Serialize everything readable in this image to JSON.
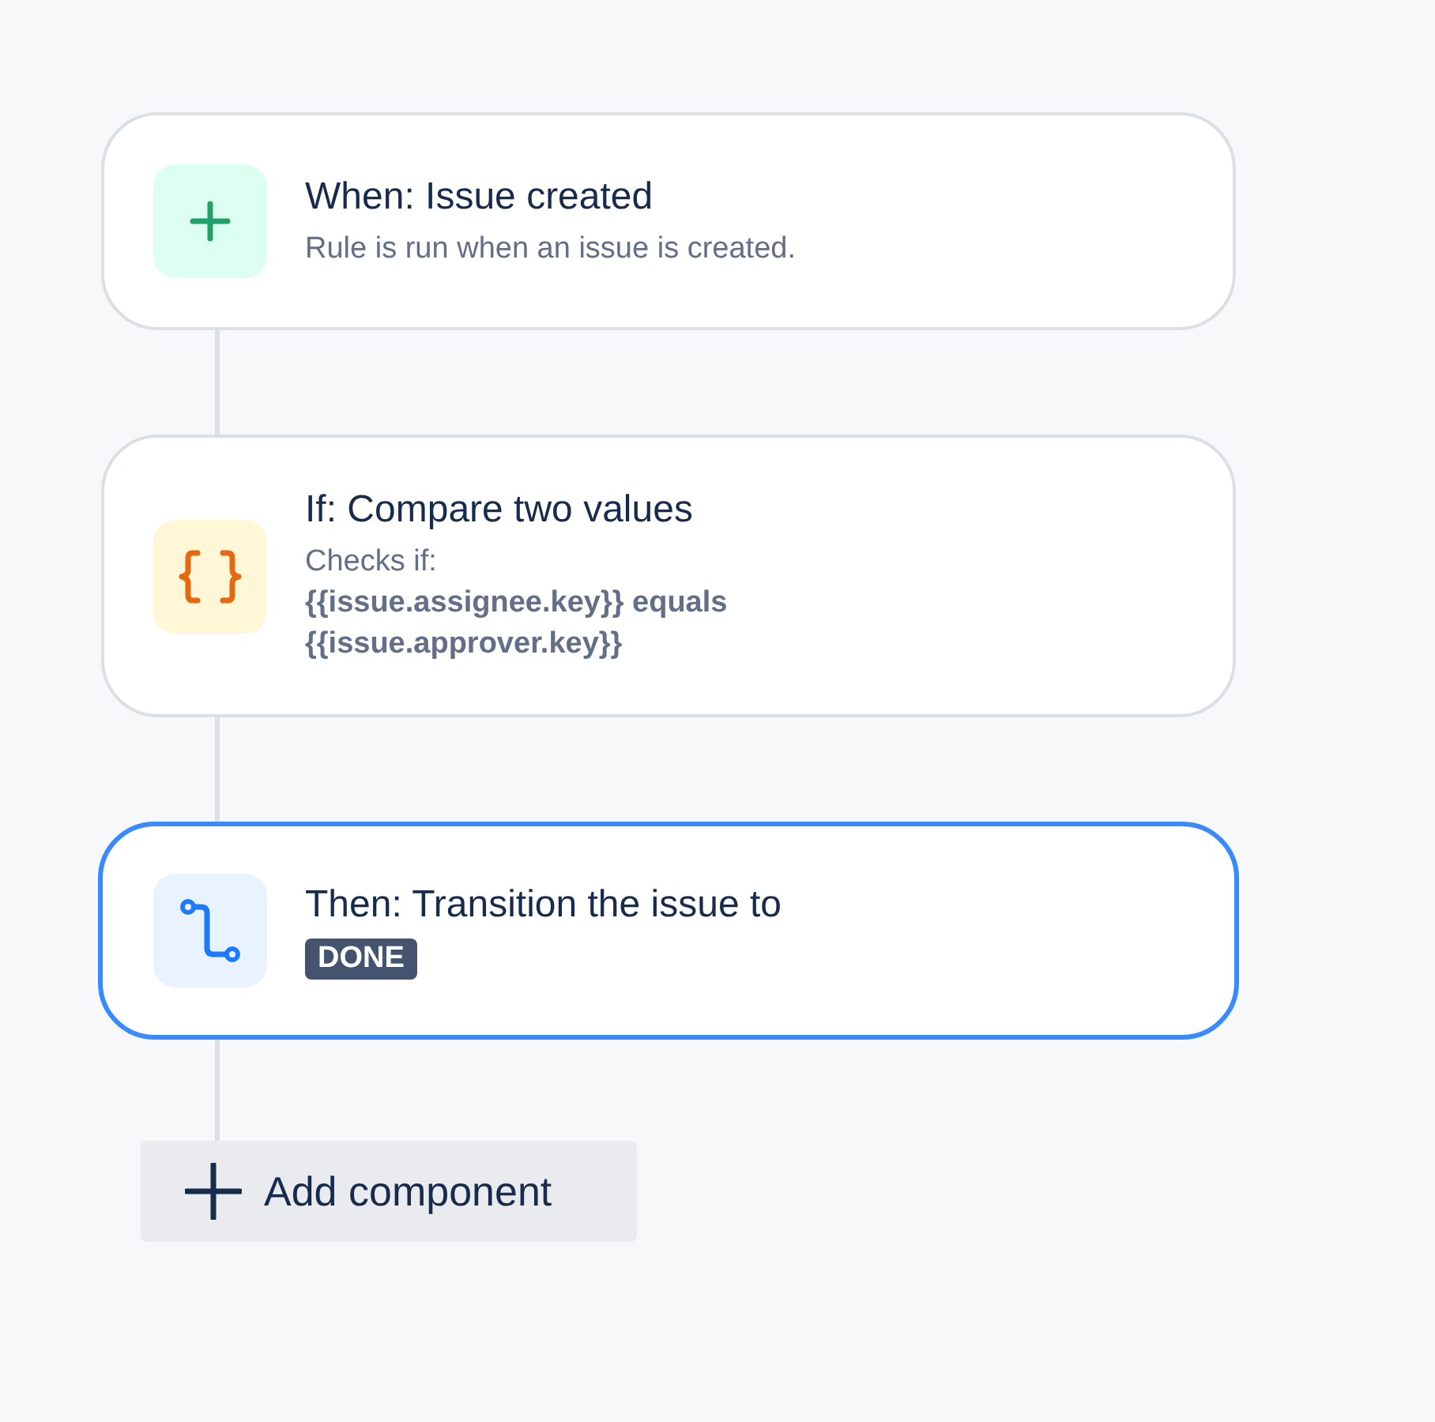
{
  "components": [
    {
      "kind": "trigger",
      "title": "When: Issue created",
      "description": "Rule is run when an issue is created.",
      "selected": false
    },
    {
      "kind": "condition",
      "title": "If: Compare two values",
      "description": "Checks if:",
      "detail": "{{issue.assignee.key}} equals {{issue.approver.key}}",
      "selected": false
    },
    {
      "kind": "action",
      "title": "Then: Transition the issue to",
      "status": "DONE",
      "selected": true
    }
  ],
  "add_button": {
    "label": "Add component"
  }
}
